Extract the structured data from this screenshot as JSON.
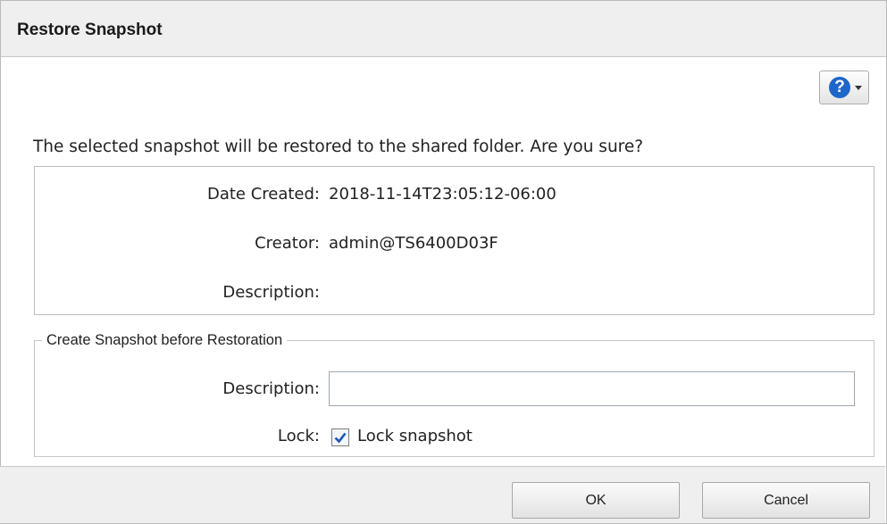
{
  "dialog": {
    "title": "Restore Snapshot"
  },
  "help": {
    "icon": "question-mark-icon",
    "glyph": "?"
  },
  "message": "The selected snapshot will be restored to the shared folder. Are you sure?",
  "info": {
    "date_created_label": "Date Created:",
    "date_created_value": "2018-11-14T23:05:12-06:00",
    "creator_label": "Creator:",
    "creator_value": "admin@TS6400D03F",
    "description_label": "Description:",
    "description_value": ""
  },
  "create_snapshot": {
    "legend": "Create Snapshot before Restoration",
    "description_label": "Description:",
    "description_value": "",
    "lock_label": "Lock:",
    "lock_checkbox_label": "Lock snapshot",
    "lock_checked": true
  },
  "buttons": {
    "ok": "OK",
    "cancel": "Cancel"
  },
  "colors": {
    "help_icon": "#1f66c9",
    "checkmark": "#1f55b4",
    "titlebar": "#efefef"
  }
}
